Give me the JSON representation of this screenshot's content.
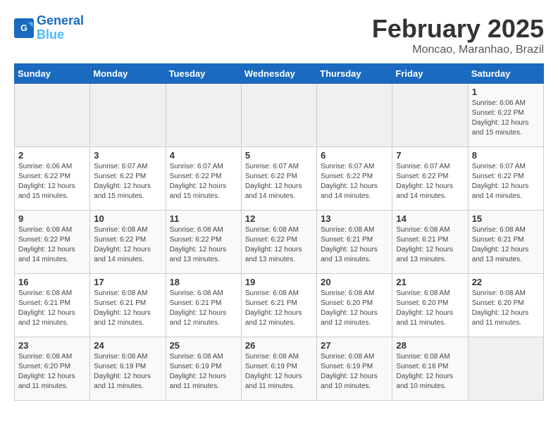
{
  "header": {
    "logo_general": "General",
    "logo_blue": "Blue",
    "title": "February 2025",
    "subtitle": "Moncao, Maranhao, Brazil"
  },
  "days_of_week": [
    "Sunday",
    "Monday",
    "Tuesday",
    "Wednesday",
    "Thursday",
    "Friday",
    "Saturday"
  ],
  "weeks": [
    [
      {
        "day": "",
        "info": ""
      },
      {
        "day": "",
        "info": ""
      },
      {
        "day": "",
        "info": ""
      },
      {
        "day": "",
        "info": ""
      },
      {
        "day": "",
        "info": ""
      },
      {
        "day": "",
        "info": ""
      },
      {
        "day": "1",
        "info": "Sunrise: 6:06 AM\nSunset: 6:22 PM\nDaylight: 12 hours\nand 15 minutes."
      }
    ],
    [
      {
        "day": "2",
        "info": "Sunrise: 6:06 AM\nSunset: 6:22 PM\nDaylight: 12 hours\nand 15 minutes."
      },
      {
        "day": "3",
        "info": "Sunrise: 6:07 AM\nSunset: 6:22 PM\nDaylight: 12 hours\nand 15 minutes."
      },
      {
        "day": "4",
        "info": "Sunrise: 6:07 AM\nSunset: 6:22 PM\nDaylight: 12 hours\nand 15 minutes."
      },
      {
        "day": "5",
        "info": "Sunrise: 6:07 AM\nSunset: 6:22 PM\nDaylight: 12 hours\nand 14 minutes."
      },
      {
        "day": "6",
        "info": "Sunrise: 6:07 AM\nSunset: 6:22 PM\nDaylight: 12 hours\nand 14 minutes."
      },
      {
        "day": "7",
        "info": "Sunrise: 6:07 AM\nSunset: 6:22 PM\nDaylight: 12 hours\nand 14 minutes."
      },
      {
        "day": "8",
        "info": "Sunrise: 6:07 AM\nSunset: 6:22 PM\nDaylight: 12 hours\nand 14 minutes."
      }
    ],
    [
      {
        "day": "9",
        "info": "Sunrise: 6:08 AM\nSunset: 6:22 PM\nDaylight: 12 hours\nand 14 minutes."
      },
      {
        "day": "10",
        "info": "Sunrise: 6:08 AM\nSunset: 6:22 PM\nDaylight: 12 hours\nand 14 minutes."
      },
      {
        "day": "11",
        "info": "Sunrise: 6:08 AM\nSunset: 6:22 PM\nDaylight: 12 hours\nand 13 minutes."
      },
      {
        "day": "12",
        "info": "Sunrise: 6:08 AM\nSunset: 6:22 PM\nDaylight: 12 hours\nand 13 minutes."
      },
      {
        "day": "13",
        "info": "Sunrise: 6:08 AM\nSunset: 6:21 PM\nDaylight: 12 hours\nand 13 minutes."
      },
      {
        "day": "14",
        "info": "Sunrise: 6:08 AM\nSunset: 6:21 PM\nDaylight: 12 hours\nand 13 minutes."
      },
      {
        "day": "15",
        "info": "Sunrise: 6:08 AM\nSunset: 6:21 PM\nDaylight: 12 hours\nand 13 minutes."
      }
    ],
    [
      {
        "day": "16",
        "info": "Sunrise: 6:08 AM\nSunset: 6:21 PM\nDaylight: 12 hours\nand 12 minutes."
      },
      {
        "day": "17",
        "info": "Sunrise: 6:08 AM\nSunset: 6:21 PM\nDaylight: 12 hours\nand 12 minutes."
      },
      {
        "day": "18",
        "info": "Sunrise: 6:08 AM\nSunset: 6:21 PM\nDaylight: 12 hours\nand 12 minutes."
      },
      {
        "day": "19",
        "info": "Sunrise: 6:08 AM\nSunset: 6:21 PM\nDaylight: 12 hours\nand 12 minutes."
      },
      {
        "day": "20",
        "info": "Sunrise: 6:08 AM\nSunset: 6:20 PM\nDaylight: 12 hours\nand 12 minutes."
      },
      {
        "day": "21",
        "info": "Sunrise: 6:08 AM\nSunset: 6:20 PM\nDaylight: 12 hours\nand 11 minutes."
      },
      {
        "day": "22",
        "info": "Sunrise: 6:08 AM\nSunset: 6:20 PM\nDaylight: 12 hours\nand 11 minutes."
      }
    ],
    [
      {
        "day": "23",
        "info": "Sunrise: 6:08 AM\nSunset: 6:20 PM\nDaylight: 12 hours\nand 11 minutes."
      },
      {
        "day": "24",
        "info": "Sunrise: 6:08 AM\nSunset: 6:19 PM\nDaylight: 12 hours\nand 11 minutes."
      },
      {
        "day": "25",
        "info": "Sunrise: 6:08 AM\nSunset: 6:19 PM\nDaylight: 12 hours\nand 11 minutes."
      },
      {
        "day": "26",
        "info": "Sunrise: 6:08 AM\nSunset: 6:19 PM\nDaylight: 12 hours\nand 11 minutes."
      },
      {
        "day": "27",
        "info": "Sunrise: 6:08 AM\nSunset: 6:19 PM\nDaylight: 12 hours\nand 10 minutes."
      },
      {
        "day": "28",
        "info": "Sunrise: 6:08 AM\nSunset: 6:18 PM\nDaylight: 12 hours\nand 10 minutes."
      },
      {
        "day": "",
        "info": ""
      }
    ]
  ]
}
